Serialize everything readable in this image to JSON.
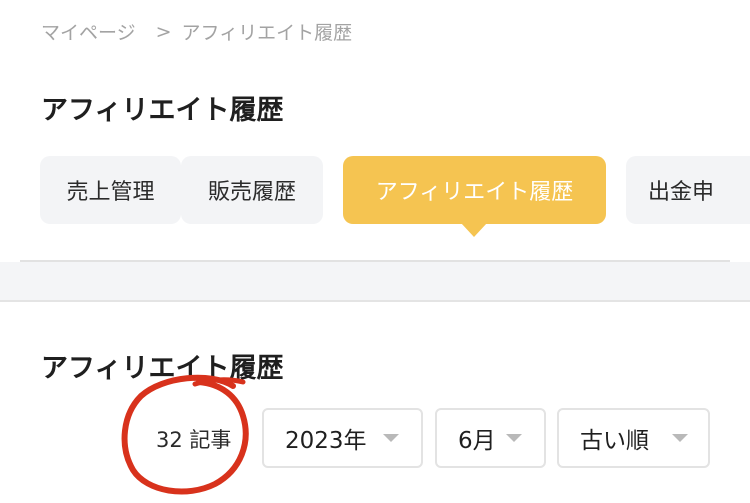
{
  "breadcrumb": {
    "items": [
      "マイページ",
      "アフィリエイト履歴"
    ],
    "separator": ">"
  },
  "page_title": "アフィリエイト履歴",
  "tabs": [
    {
      "label": "売上管理",
      "active": false
    },
    {
      "label": "販売履歴",
      "active": false
    },
    {
      "label": "アフィリエイト履歴",
      "active": true
    },
    {
      "label": "出金申",
      "active": false
    }
  ],
  "section": {
    "title": "アフィリエイト履歴",
    "count_label": "32 記事"
  },
  "filters": {
    "year": "2023年",
    "month": "6月",
    "order": "古い順"
  },
  "colors": {
    "accent": "#f5c451",
    "tab_bg": "#f3f4f6",
    "annotation": "#d8321c"
  },
  "icons": {
    "dropdown": "caret-down-icon"
  }
}
